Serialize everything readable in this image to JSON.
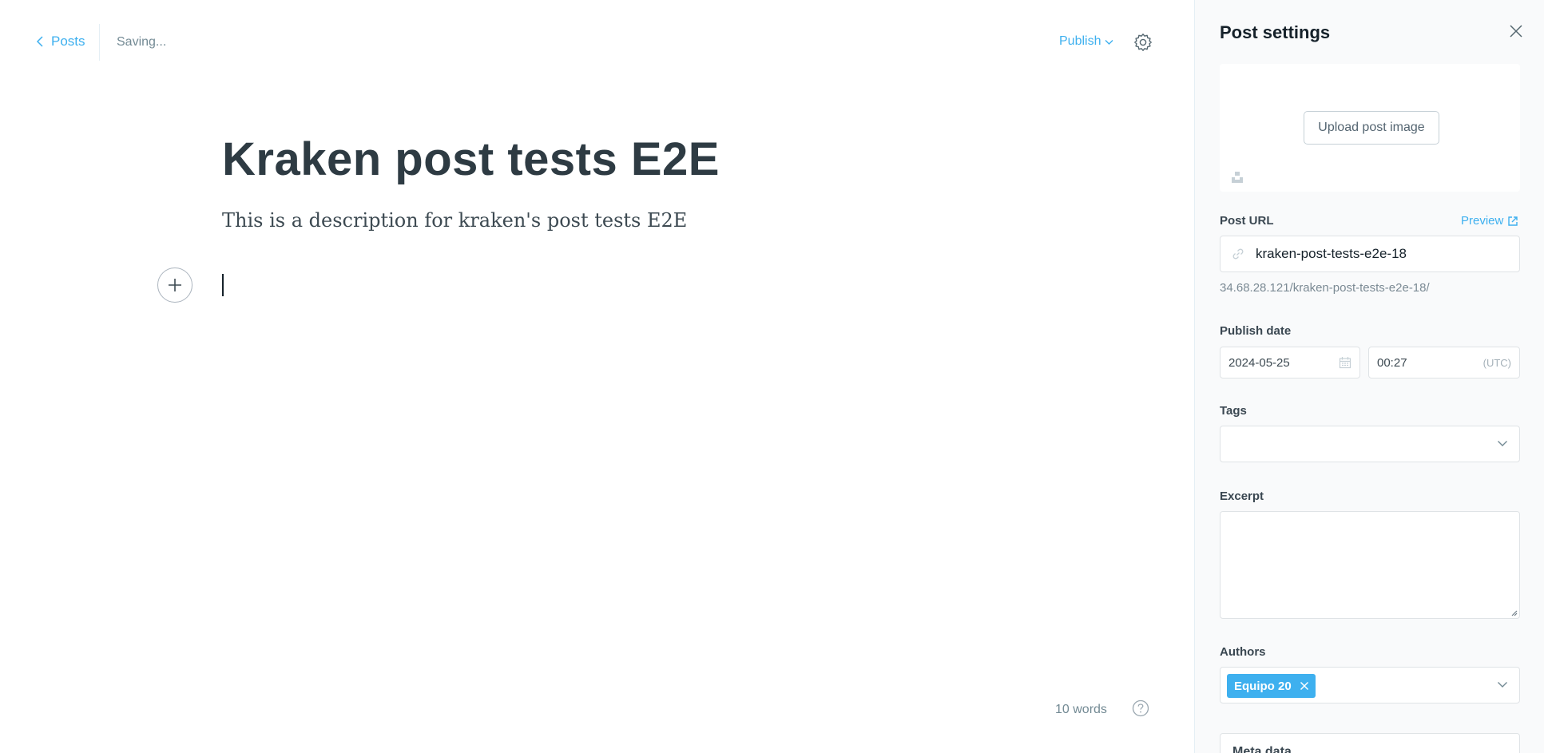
{
  "header": {
    "back_label": "Posts",
    "status": "Saving...",
    "publish_label": "Publish"
  },
  "post": {
    "title": "Kraken post tests E2E",
    "description": "This is a description for kraken's post tests E2E"
  },
  "footer": {
    "word_count": "10 words"
  },
  "settings": {
    "title": "Post settings",
    "upload_image_label": "Upload post image",
    "post_url_label": "Post URL",
    "preview_label": "Preview",
    "slug": "kraken-post-tests-e2e-18",
    "full_url": "34.68.28.121/kraken-post-tests-e2e-18/",
    "publish_date_label": "Publish date",
    "date": "2024-05-25",
    "time": "00:27",
    "timezone": "(UTC)",
    "tags_label": "Tags",
    "excerpt_label": "Excerpt",
    "authors_label": "Authors",
    "author_token": "Equipo 20",
    "meta_data_label": "Meta data"
  },
  "colors": {
    "accent": "#3eb0ef",
    "title_text": "#2e3b43",
    "muted_text": "#738a94",
    "panel_bg": "#f9fafb",
    "border": "#dfe3e6"
  },
  "icons": [
    "chevron-left-icon",
    "chevron-down-icon",
    "gear-icon",
    "plus-icon",
    "help-icon",
    "close-icon",
    "unsplash-icon",
    "link-icon",
    "external-link-icon",
    "calendar-icon"
  ]
}
